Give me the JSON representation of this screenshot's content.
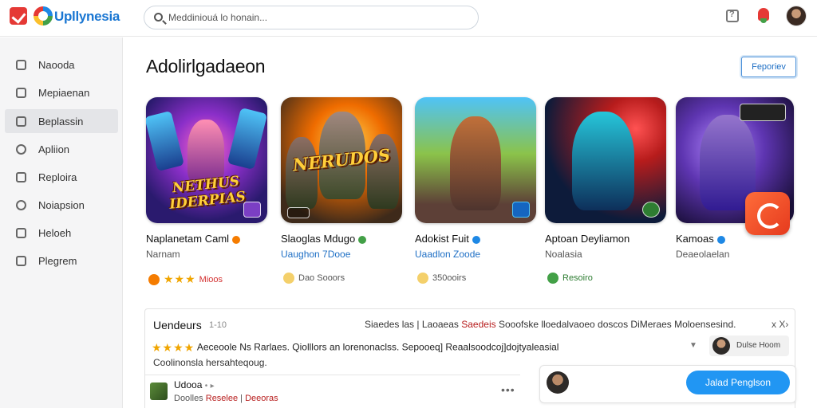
{
  "header": {
    "logo_text": "Upllynesia",
    "search_placeholder": "Meddiniouá lo honain..."
  },
  "sidebar": {
    "items": [
      {
        "label": "Naooda",
        "icon": "shield-icon"
      },
      {
        "label": "Mepiaenan",
        "icon": "grid-icon"
      },
      {
        "label": "Beplassin",
        "icon": "cube-icon"
      },
      {
        "label": "Apliion",
        "icon": "pin-icon"
      },
      {
        "label": "Reploira",
        "icon": "box-icon"
      },
      {
        "label": "Noiapsion",
        "icon": "search-icon"
      },
      {
        "label": "Heloeh",
        "icon": "lock-icon"
      },
      {
        "label": "Plegrem",
        "icon": "page-icon"
      }
    ],
    "active_index": 2
  },
  "main": {
    "title": "Adolirlgadaeon",
    "top_button": "Feporiev"
  },
  "cards": [
    {
      "title": "Naplanetam Caml",
      "subtitle": "Narnam",
      "subtitle_color": "gray",
      "art_text": "NETHUS IDERPIAS",
      "meta_stars": "★★★",
      "meta_text": "Mioos",
      "verified_color": "#f57c00",
      "meta_dot_color": "#f57c00",
      "meta_type": "stars"
    },
    {
      "title": "Slaoglas Mdugo",
      "subtitle": "Uaughon 7Dooe",
      "subtitle_color": "blue",
      "art_text": "NERUDOS",
      "meta_text": "Dao Sooors",
      "verified_color": "#43a047",
      "meta_dot_color": "#f4d06b",
      "meta_type": "dot"
    },
    {
      "title": "Adokist Fuit",
      "subtitle": "Uaadlon Zoode",
      "subtitle_color": "blue",
      "art_text": "",
      "meta_text": "350ooirs",
      "verified_color": "#1e88e5",
      "meta_dot_color": "#f4d06b",
      "meta_type": "dot"
    },
    {
      "title": "Aptoan Deyliamon",
      "subtitle": "Noalasia",
      "subtitle_color": "gray",
      "art_text": "",
      "meta_text": "Resoiro",
      "verified_color": "",
      "meta_dot_color": "#43a047",
      "meta_type": "check"
    },
    {
      "title": "Kamoas",
      "subtitle": "Deaeolaelan",
      "subtitle_color": "gray",
      "art_text": "",
      "meta_text": "",
      "verified_color": "#1e88e5",
      "meta_dot_color": "",
      "meta_type": "none"
    }
  ],
  "reviews": {
    "title": "Uendeurs",
    "count": "1-10",
    "filter_prefix": "Siaedes las",
    "filter_sep": "|",
    "filter_mid": "Laoaeas",
    "filter_red": "Saedeis",
    "filter_suffix": "Sooofske lloedalvaoeo doscos  DiMeraes  Moloensesind.",
    "close": "x X›",
    "review_stars": "★★★★",
    "review_text": "Aeceoole Ns Rarlaes. Qiolllors an lorenonaclss. Sepooeq] Reaalsoodcoj]dojtyaleasial",
    "review_line2": "Coolinonsla hersahteqoug.",
    "chip_text": "Dulse Hoom",
    "row_name": "Udooa",
    "row_dot": "•",
    "row_tag_prefix": "Doolles",
    "row_tag_red": "Reselee",
    "row_tag_sep": "|",
    "row_tag_suffix": "Deeoras",
    "more": "•••"
  },
  "reply": {
    "button_label": "Jalad Penglson"
  },
  "colors": {
    "accent_blue": "#2196f3",
    "logo_red": "#e53935",
    "star_gold": "#f0a500"
  }
}
